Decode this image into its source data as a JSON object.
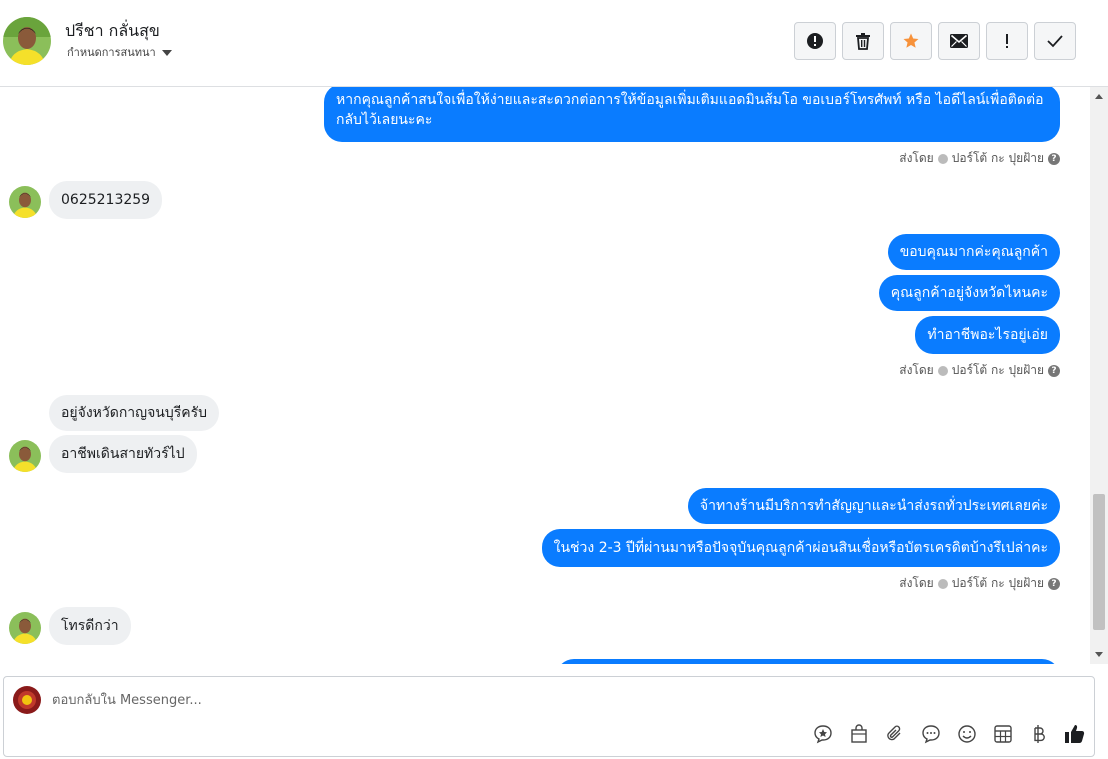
{
  "header": {
    "contact_name": "ปรีชา กลั่นสุข",
    "assign_label": "กำหนดการสนทนา"
  },
  "actions": [
    {
      "name": "mark-spam-button",
      "icon": "alert-circle-icon"
    },
    {
      "name": "delete-button",
      "icon": "trash-icon"
    },
    {
      "name": "star-button",
      "icon": "star-icon"
    },
    {
      "name": "mark-unread-button",
      "icon": "envelope-icon"
    },
    {
      "name": "follow-up-button",
      "icon": "exclamation-icon"
    },
    {
      "name": "mark-done-button",
      "icon": "check-icon"
    }
  ],
  "messages": {
    "m1": "หากคุณลูกค้าสนใจเพื่อให้ง่ายและสะดวกต่อการให้ข้อมูลเพิ่มเติมแอดมินส้มโอ ขอเบอร์โทรศัพท์ หรือ ไอดีไลน์เพื่อติดต่อกลับไว้เลยนะคะ",
    "m2": "0625213259",
    "m3": "ขอบคุณมากค่ะคุณลูกค้า",
    "m4": "คุณลูกค้าอยู่จังหวัดไหนคะ",
    "m5": "ทำอาชีพอะไรอยู่เอ่ย",
    "m6": "อยู่จังหวัดกาญจนบุรีครับ",
    "m7": "อาชีพเดินสายทัวร์ไป",
    "m8": "จ้าทางร้านมีบริการทำสัญญาและนำส่งรถทั่วประเทศเลยค่ะ",
    "m9": "ในช่วง 2-3 ปีที่ผ่านมาหรือปัจจุบันคุณลูกค้าผ่อนสินเชื่อหรือบัตรเครดิตบ้างรึเปล่าคะ",
    "m10": "โทรดีกว่า"
  },
  "sent_by": {
    "label": "ส่งโดย",
    "agent": "ปอร์โต้ กะ ปุยฝ้าย"
  },
  "composer": {
    "placeholder": "ตอบกลับใน Messenger..."
  },
  "colors": {
    "outgoing_bubble": "#0a7cff",
    "incoming_bubble": "#eef0f2",
    "star": "#f7923b"
  }
}
